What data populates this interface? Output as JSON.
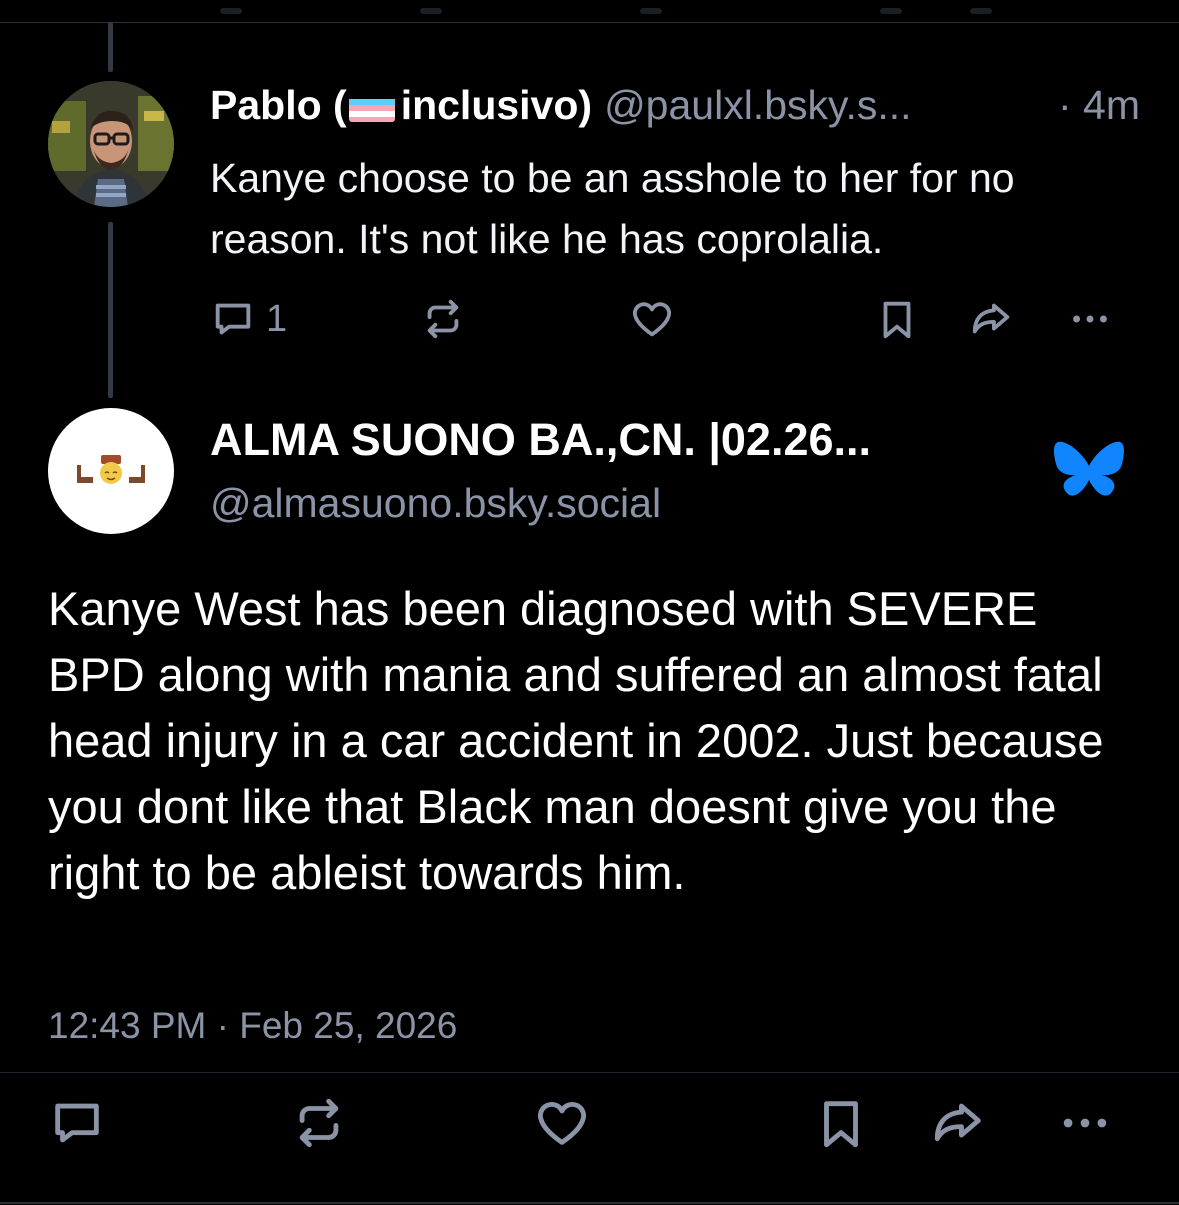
{
  "reply": {
    "name_prefix": "Pablo (",
    "name_suffix": "inclusivo)",
    "flag_icon": "transgender-flag-emoji",
    "handle": "@paulxl.bsky.s...",
    "time": "· 4m",
    "text": "Kanye choose to be an asshole to her for no reason.  It's not like he has coprolalia.",
    "reply_count": "1"
  },
  "post": {
    "author_name": "ALMA SUONO BA.,CN. |02.26...",
    "author_handle": "@almasuono.bsky.social",
    "badge_icon": "bluesky-butterfly-icon",
    "badge_color": "#1185fe",
    "text": "Kanye West has been diagnosed with SEVERE BPD along with mania and suffered an almost fatal head injury in a car accident in 2002. Just because you dont like that Black man doesnt give you the right to be ableist towards him.",
    "timestamp": "12:43 PM · Feb 25, 2026"
  },
  "colors": {
    "background": "#000000",
    "muted_text": "#8b94a6",
    "thread_line": "#343a44"
  }
}
